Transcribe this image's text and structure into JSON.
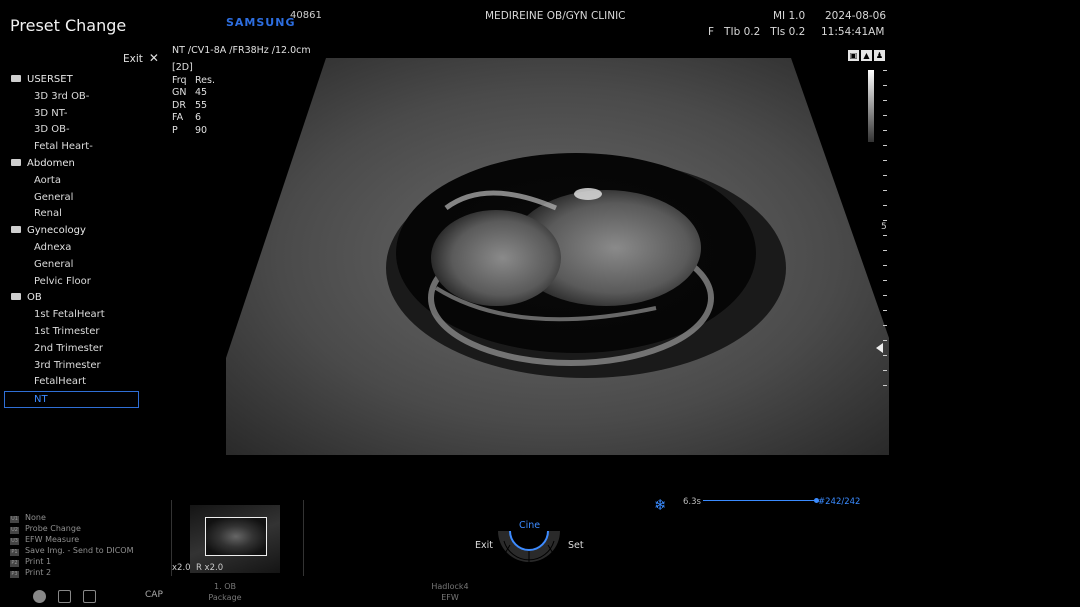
{
  "header": {
    "title": "Preset Change",
    "exit_label": "Exit",
    "brand": "SAMSUNG",
    "patient_id": "40861",
    "clinic": "MEDIREINE OB/GYN CLINIC",
    "mi": "MI 1.0",
    "date": "2024-08-06",
    "thermal": "F   TIb 0.2   TIs 0.2",
    "time": "11:54:41AM"
  },
  "probe_info": "NT /CV1-8A /FR38Hz /12.0cm",
  "params": {
    "mode": "[2D]",
    "rows": [
      {
        "k": "Frq",
        "v": "Res."
      },
      {
        "k": "GN",
        "v": "45"
      },
      {
        "k": "DR",
        "v": "55"
      },
      {
        "k": "FA",
        "v": "6"
      },
      {
        "k": "P",
        "v": "90"
      }
    ]
  },
  "presets": {
    "folders": [
      {
        "label": "USERSET",
        "items": [
          "3D 3rd OB-",
          "3D NT-",
          "3D OB-",
          "Fetal Heart-"
        ]
      },
      {
        "label": "Abdomen",
        "items": [
          "Aorta",
          "General",
          "Renal"
        ]
      },
      {
        "label": "Gynecology",
        "items": [
          "Adnexa",
          "General",
          "Pelvic Floor"
        ]
      },
      {
        "label": "OB",
        "items": [
          "1st FetalHeart",
          "1st Trimester",
          "2nd Trimester",
          "3rd Trimester",
          "FetalHeart",
          "NT"
        ]
      }
    ],
    "selected": "NT"
  },
  "depth_marker": "5",
  "cine": {
    "time": "6.3s",
    "frames": "#242/242"
  },
  "user_menu": [
    {
      "key": "U1",
      "label": "None"
    },
    {
      "key": "U2",
      "label": "Probe Change"
    },
    {
      "key": "U3",
      "label": "EFW Measure"
    },
    {
      "key": "P1",
      "label": "Save Img. - Send to DICOM"
    },
    {
      "key": "P2",
      "label": "Print 1"
    },
    {
      "key": "P3",
      "label": "Print 2"
    }
  ],
  "cap_label": "CAP",
  "thumbnail": {
    "zoom": "x2.0  R x2.0",
    "package_line1": "1. OB",
    "package_line2": "Package"
  },
  "hadlock": {
    "line1": "Hadlock4",
    "line2": "EFW"
  },
  "dial": {
    "top": "Cine",
    "left": "Exit",
    "right": "Set"
  },
  "icons": [
    "freeze-snowflake-icon",
    "folder-icon"
  ]
}
